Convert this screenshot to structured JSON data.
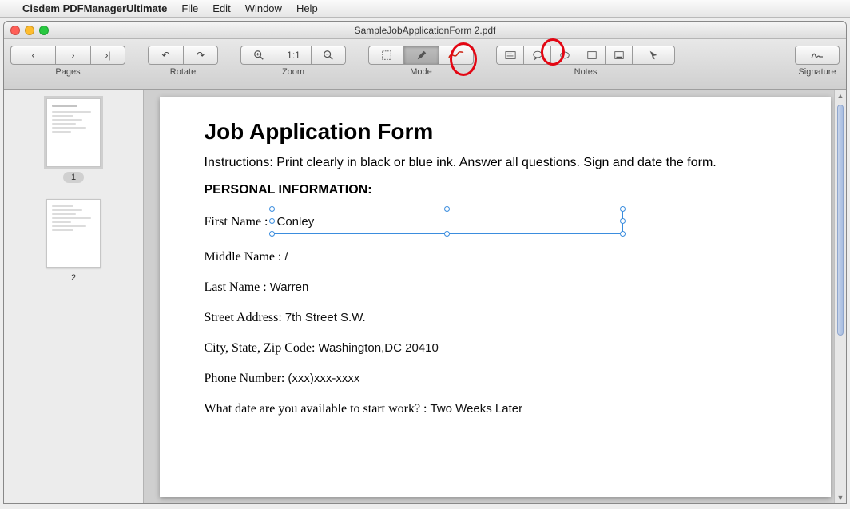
{
  "menubar": {
    "apple": "",
    "app_name": "Cisdem PDFManagerUltimate",
    "items": [
      "File",
      "Edit",
      "Window",
      "Help"
    ]
  },
  "window": {
    "title": "SampleJobApplicationForm 2.pdf"
  },
  "toolbar": {
    "pages_label": "Pages",
    "rotate_label": "Rotate",
    "zoom_label": "Zoom",
    "mode_label": "Mode",
    "notes_label": "Notes",
    "signature_label": "Signature",
    "zoom_fit": "1:1"
  },
  "sidebar": {
    "thumbs": [
      {
        "label": "1"
      },
      {
        "label": "2"
      }
    ]
  },
  "doc": {
    "title": "Job Application Form",
    "instructions": "Instructions: Print clearly in black or blue ink. Answer all questions. Sign and date the form.",
    "section_personal": "PERSONAL INFORMATION:",
    "rows": {
      "first_name_label": "First Name :",
      "first_name_value": "Conley",
      "middle_name_label": "Middle Name :",
      "middle_name_value": "/",
      "last_name_label": "Last Name :",
      "last_name_value": "Warren",
      "street_label": "Street Address:",
      "street_value": "7th Street S.W.",
      "city_label": "City, State, Zip Code:",
      "city_value": "Washington,DC 20410",
      "phone_label": "Phone Number:",
      "phone_value": "(xxx)xxx-xxxx",
      "startdate_label": "What date are you available to start work? :",
      "startdate_value": "Two Weeks Later"
    }
  }
}
